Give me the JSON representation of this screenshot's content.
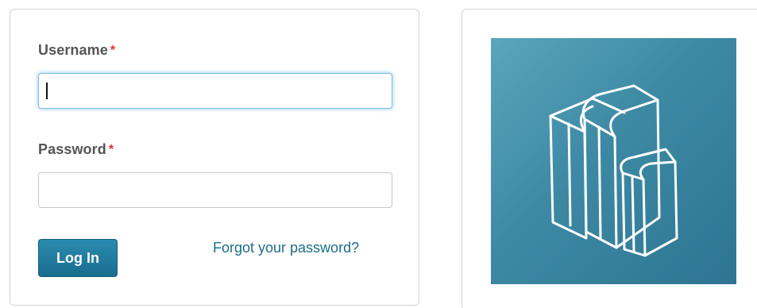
{
  "login_form": {
    "username_label": "Username",
    "password_label": "Password",
    "required_marker": "*",
    "username_value": "",
    "password_value": "",
    "login_button_label": "Log In",
    "forgot_password_link": "Forgot your password?"
  },
  "illustration": {
    "icon": "books-icon"
  },
  "colors": {
    "accent": "#1e6c8c",
    "button": "#1a6e8e",
    "required": "#e03030",
    "tile": "#3d89a4"
  }
}
